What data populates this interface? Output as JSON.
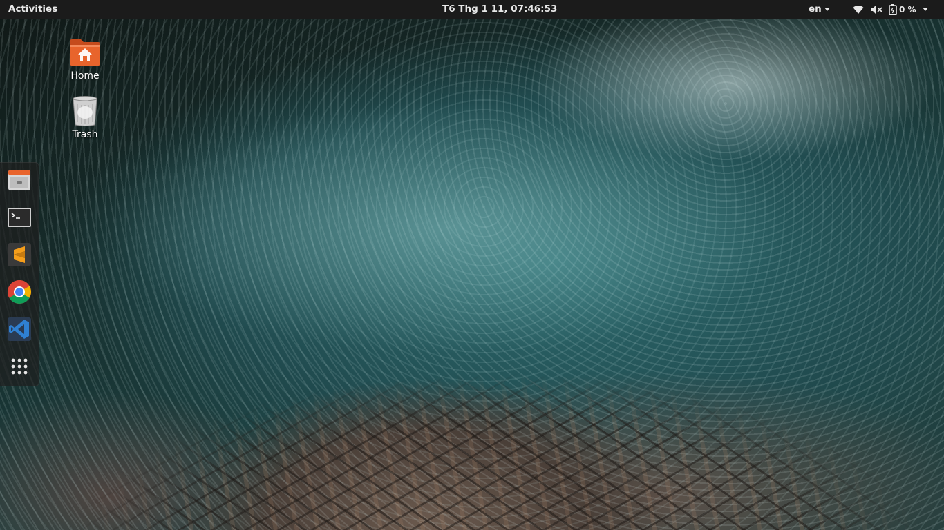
{
  "topbar": {
    "activities_label": "Activities",
    "clock": "T6 Thg 1 11, 07:46:53",
    "language": "en",
    "battery_percent": "0 %",
    "icons": [
      "wifi-icon",
      "volume-muted-icon",
      "battery-icon",
      "chevron-down-icon"
    ]
  },
  "desktop": {
    "icons": [
      {
        "label": "Home",
        "icon": "home-folder-icon"
      },
      {
        "label": "Trash",
        "icon": "trash-icon"
      }
    ]
  },
  "dock": {
    "items": [
      {
        "name": "files",
        "icon": "file-manager-icon"
      },
      {
        "name": "terminal",
        "icon": "terminal-icon"
      },
      {
        "name": "sublime-text",
        "icon": "sublime-text-icon"
      },
      {
        "name": "chrome",
        "icon": "chrome-icon"
      },
      {
        "name": "vscode",
        "icon": "vscode-icon"
      },
      {
        "name": "show-applications",
        "icon": "app-grid-icon"
      }
    ]
  },
  "colors": {
    "panel_bg": "#1b1b1b",
    "panel_text": "#e8e8e8",
    "home_folder": "#e8642c",
    "sublime_accent": "#f59e1b",
    "vscode_blue": "#2f80d1"
  }
}
